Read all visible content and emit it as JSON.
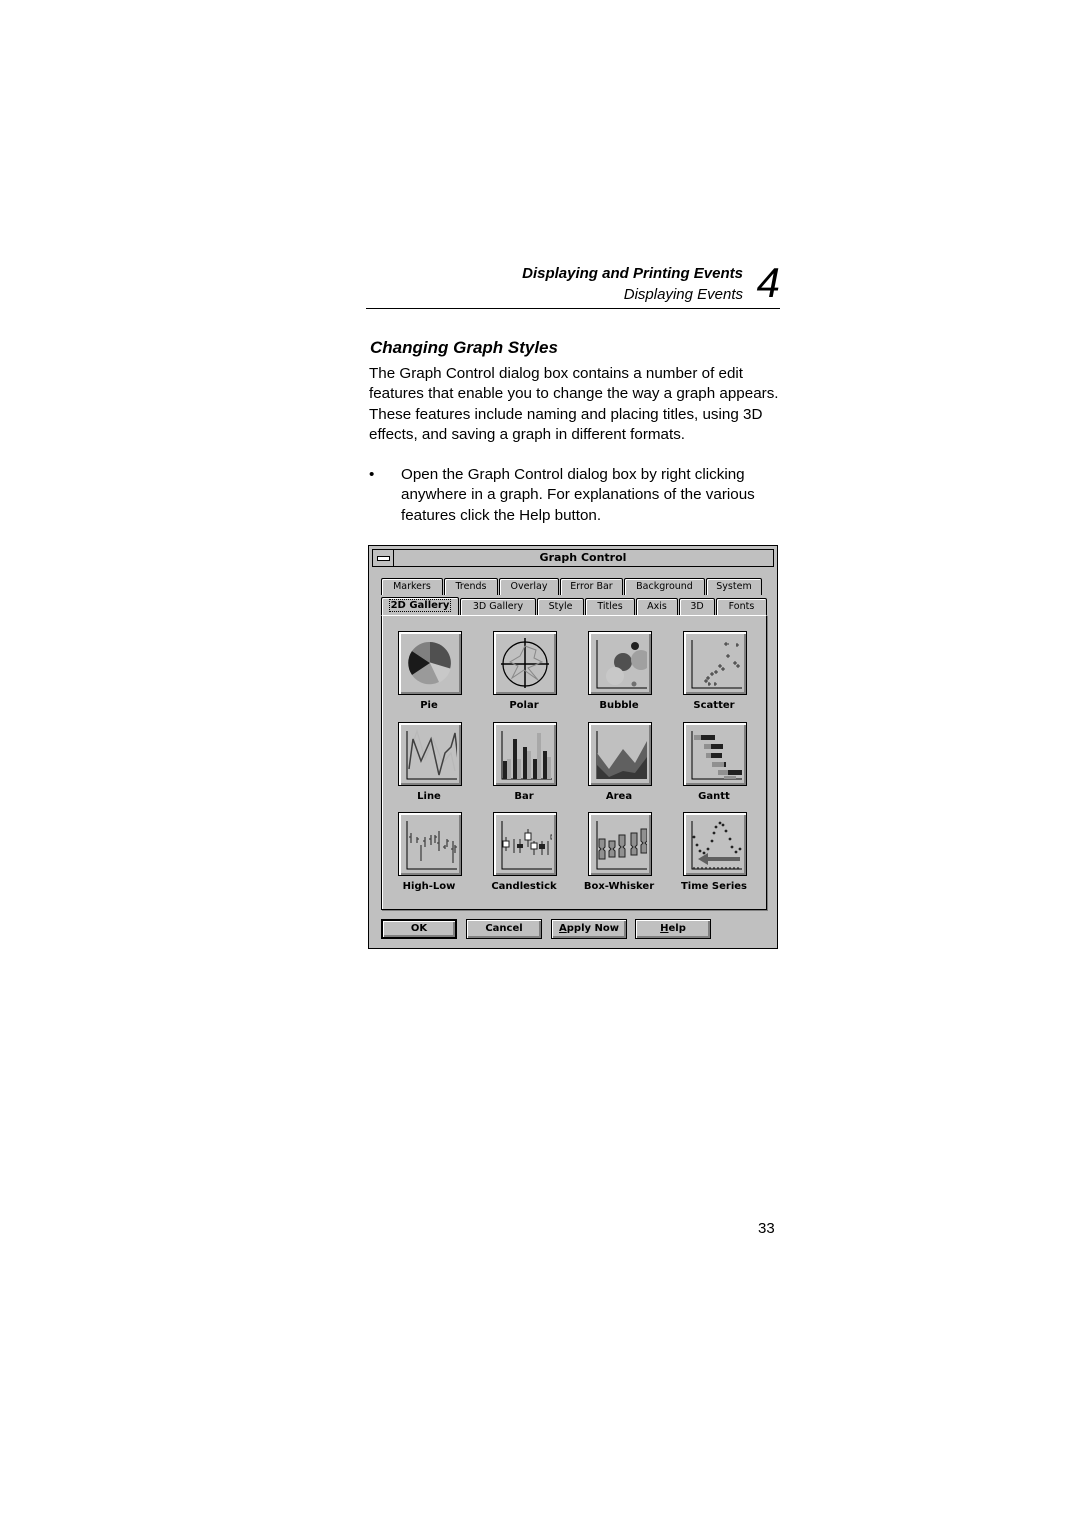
{
  "header": {
    "chapter_title": "Displaying and Printing Events",
    "section_title": "Displaying Events",
    "chapter_number": "4"
  },
  "section": {
    "title": "Changing Graph Styles",
    "paragraph": "The Graph Control dialog box contains a number of edit features that enable you to change the way a graph appears. These features include naming and placing titles, using 3D effects, and saving a graph in different formats.",
    "bullet_symbol": "•",
    "bullet_text": "Open the Graph Control dialog box by right clicking anywhere in a graph. For explanations of the various features click the Help button."
  },
  "dialog": {
    "title": "Graph Control",
    "tabs_back_row": [
      "Markers",
      "Trends",
      "Overlay",
      "Error Bar",
      "Background",
      "System"
    ],
    "tabs_front_row": [
      "2D Gallery",
      "3D Gallery",
      "Style",
      "Titles",
      "Axis",
      "3D",
      "Fonts"
    ],
    "active_tab": "2D Gallery",
    "gallery": [
      {
        "label": "Pie",
        "icon": "pie-chart-icon"
      },
      {
        "label": "Polar",
        "icon": "polar-chart-icon"
      },
      {
        "label": "Bubble",
        "icon": "bubble-chart-icon"
      },
      {
        "label": "Scatter",
        "icon": "scatter-chart-icon"
      },
      {
        "label": "Line",
        "icon": "line-chart-icon"
      },
      {
        "label": "Bar",
        "icon": "bar-chart-icon"
      },
      {
        "label": "Area",
        "icon": "area-chart-icon"
      },
      {
        "label": "Gantt",
        "icon": "gantt-chart-icon"
      },
      {
        "label": "High-Low",
        "icon": "high-low-chart-icon"
      },
      {
        "label": "Candlestick",
        "icon": "candlestick-chart-icon"
      },
      {
        "label": "Box-Whisker",
        "icon": "box-whisker-chart-icon"
      },
      {
        "label": "Time Series",
        "icon": "time-series-chart-icon"
      }
    ],
    "buttons": {
      "ok": "OK",
      "cancel": "Cancel",
      "apply_prefix": "A",
      "apply_rest": "pply Now",
      "help_prefix": "H",
      "help_rest": "elp"
    }
  },
  "page_number": "33"
}
